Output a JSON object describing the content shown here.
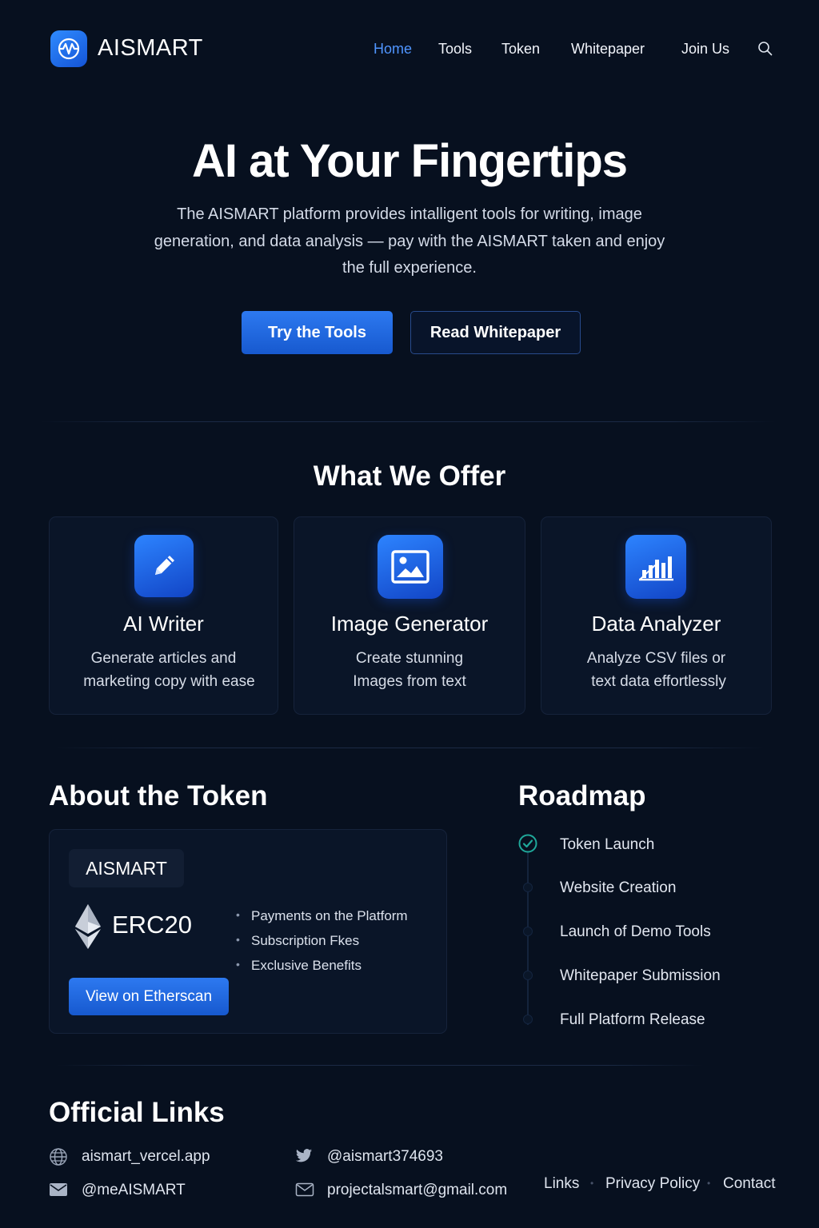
{
  "header": {
    "brand": "AISMART",
    "nav": [
      "Home",
      "Tools",
      "Token",
      "Whitepaper",
      "Join Us"
    ],
    "active_nav": "Home",
    "search_icon": "search-icon"
  },
  "hero": {
    "title": "AI at Your Fingertips",
    "description": "The AISMART platform provides intalligent tools for writing, image generation, and data analysis — pay with the AISMART taken and enjoy the full experience.",
    "primary_button": "Try the Tools",
    "secondary_button": "Read Whitepaper"
  },
  "offer": {
    "title": "What We Offer",
    "cards": [
      {
        "icon": "pencil-icon",
        "title": "AI Writer",
        "line1": "Generate articles and",
        "line2": "marketing copy with ease"
      },
      {
        "icon": "image-icon",
        "title": "Image Generator",
        "line1": "Create stunning",
        "line2": "Images from text"
      },
      {
        "icon": "bar-chart-icon",
        "title": "Data Analyzer",
        "line1": "Analyze CSV files or",
        "line2": "text data effortlessly"
      }
    ]
  },
  "token": {
    "title": "About the Token",
    "name": "AISMART",
    "standard": "ERC20",
    "standard_icon": "ethereum-icon",
    "features": [
      "Payments on the Platform",
      "Subscription Fkes",
      "Exclusive Benefits"
    ],
    "button": "View on Etherscan"
  },
  "roadmap": {
    "title": "Roadmap",
    "items": [
      {
        "label": "Token Launch",
        "done": true
      },
      {
        "label": "Website Creation",
        "done": false
      },
      {
        "label": "Launch of Demo Tools",
        "done": false
      },
      {
        "label": "Whitepaper Submission",
        "done": false
      },
      {
        "label": "Full Platform Release",
        "done": false
      }
    ]
  },
  "links": {
    "title": "Official Links",
    "website": "aismart_vercel.app",
    "twitter": "@aismart374693",
    "telegram": "@meAISMART",
    "email": "projectalsmart@gmail.com"
  },
  "footer": {
    "links": [
      "Links",
      "Privacy Policy",
      "Contact"
    ]
  },
  "colors": {
    "background": "#07101f",
    "accent": "#2d79f0",
    "active_nav": "#4f95ff",
    "check": "#1fa89a"
  }
}
